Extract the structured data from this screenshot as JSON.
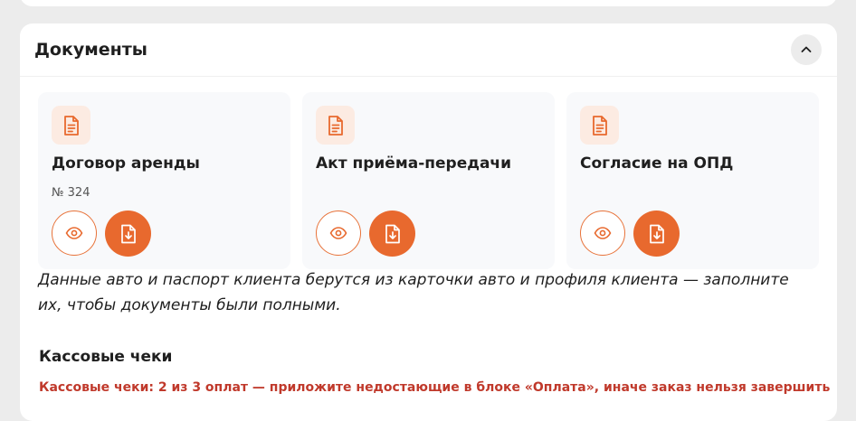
{
  "documents_section": {
    "title": "Документы",
    "collapse_icon": "chevron-up-icon",
    "cards": [
      {
        "title": "Договор аренды",
        "number": "№ 324",
        "icon": "document-icon",
        "view_icon": "eye-icon",
        "download_icon": "file-download-icon"
      },
      {
        "title": "Акт приёма-передачи",
        "icon": "document-icon",
        "view_icon": "eye-icon",
        "download_icon": "file-download-icon"
      },
      {
        "title": "Согласие на ОПД",
        "icon": "document-icon",
        "view_icon": "eye-icon",
        "download_icon": "file-download-icon"
      }
    ],
    "note": "Данные авто и паспорт клиента берутся из карточки авто и профиля клиента — заполните их, чтобы документы были полными."
  },
  "receipts": {
    "title": "Кассовые чеки",
    "warning": "Кассовые чеки: 2 из 3 оплат — приложите недостающие в блоке «Оплата», иначе заказ нельзя завершить"
  },
  "colors": {
    "accent": "#e8692e",
    "accent_light": "#fcebe2",
    "warning": "#c0392b",
    "background": "#ececec"
  }
}
